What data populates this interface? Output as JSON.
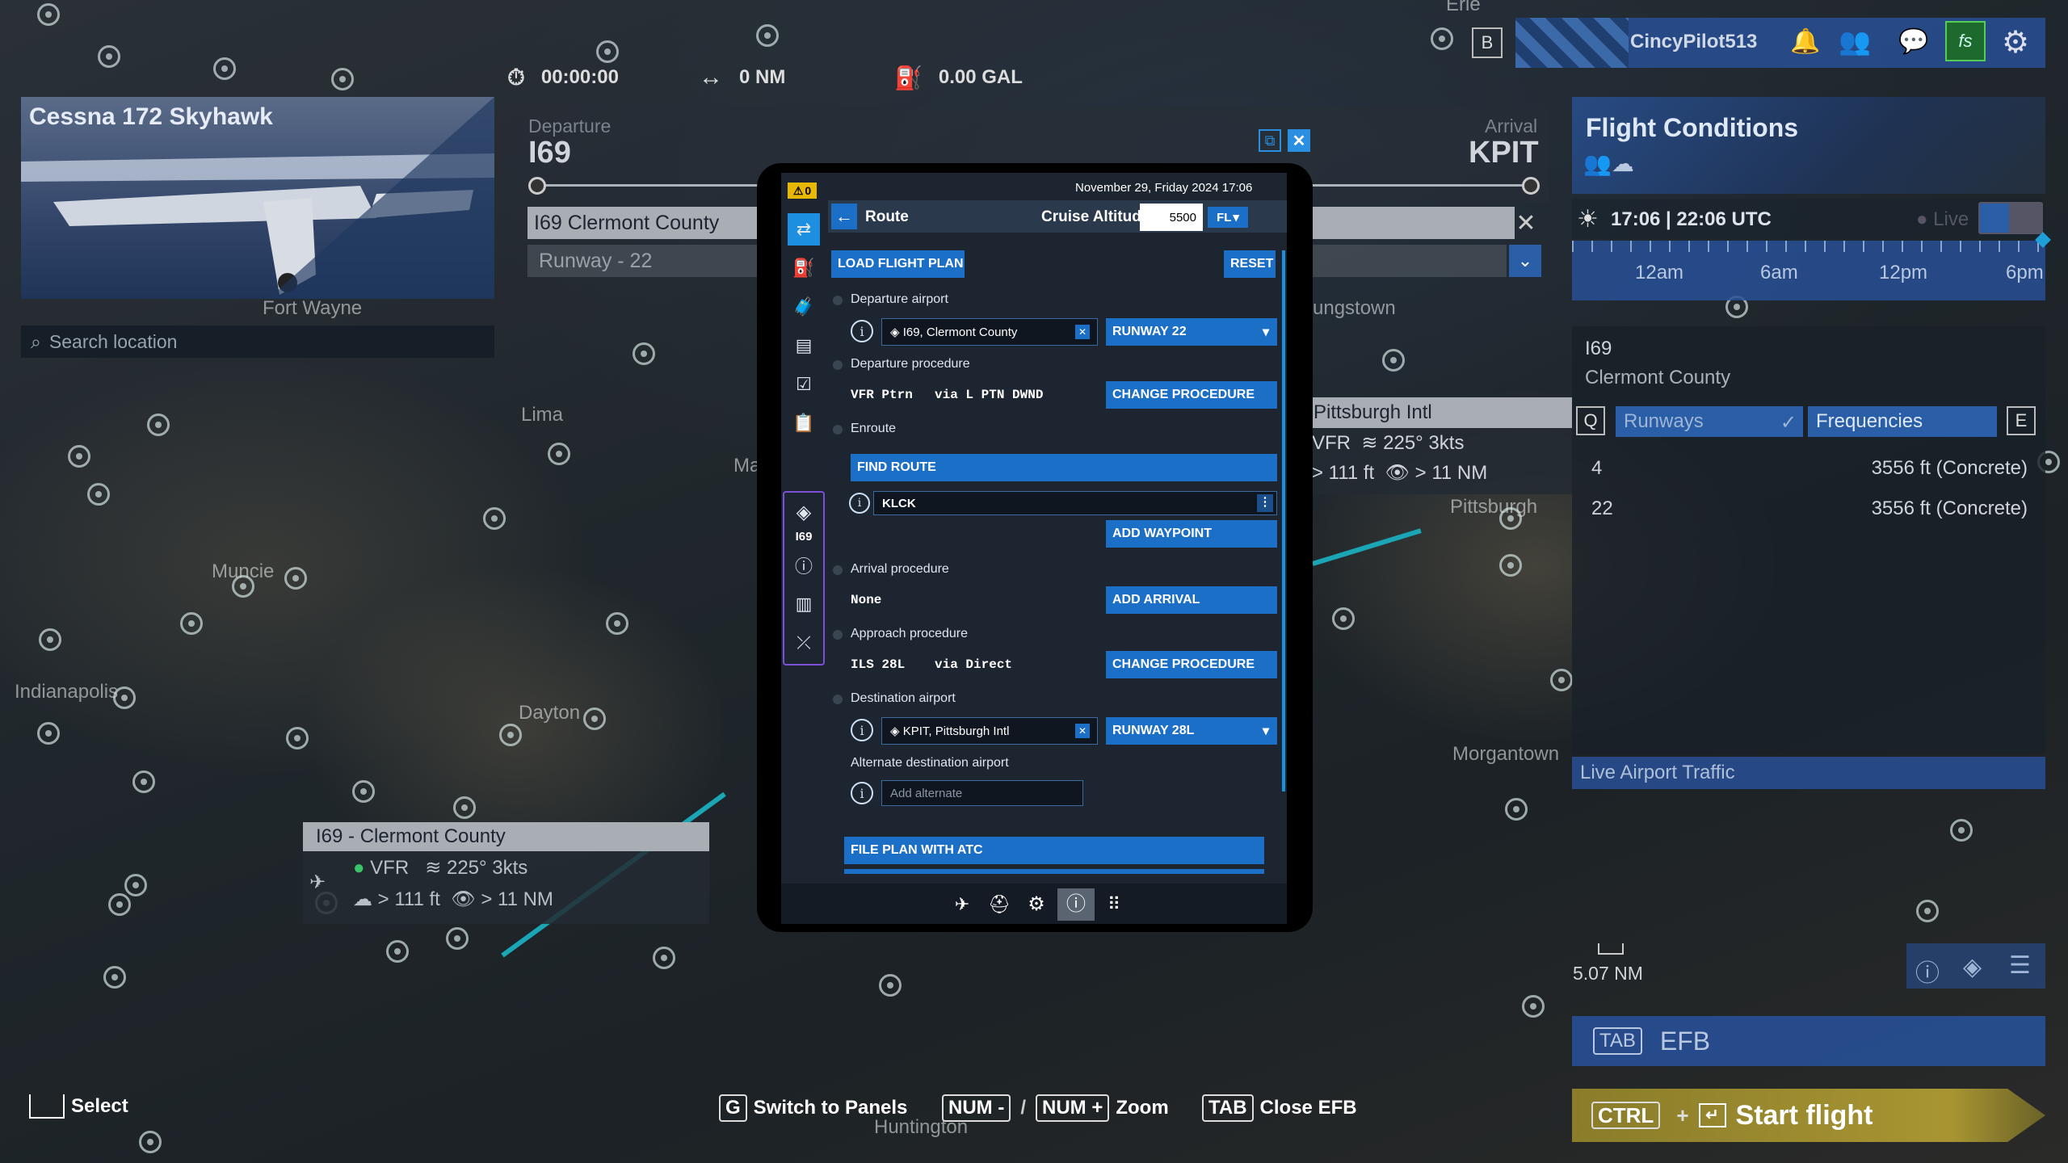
{
  "map": {
    "cities": [
      "Fort Wayne",
      "Lima",
      "Muncie",
      "Indianapolis",
      "Dayton",
      "Pittsburgh",
      "Morgantown",
      "Huntington",
      "Ma",
      "ungstown",
      "Erie"
    ]
  },
  "stats": {
    "time": "00:00:00",
    "distance": "0 NM",
    "fuel": "0.00 GAL"
  },
  "aircraft": {
    "name": "Cessna 172 Skyhawk",
    "search_placeholder": "Search location"
  },
  "departure": {
    "label": "Departure",
    "code": "I69",
    "name": "I69 Clermont County",
    "runway": "Runway - 22"
  },
  "arrival": {
    "label": "Arrival",
    "code": "KPIT"
  },
  "user": {
    "b_key": "B",
    "name": "CincyPilot513"
  },
  "flight_conditions": {
    "title": "Flight Conditions",
    "time": "17:06 | 22:06 UTC",
    "live": "Live",
    "ticks": [
      "12am",
      "6am",
      "12pm",
      "6pm"
    ]
  },
  "airport_info": {
    "code": "I69",
    "name": "Clermont County",
    "q_key": "Q",
    "e_key": "E",
    "tab_runways": "Runways",
    "tab_frequencies": "Frequencies",
    "runways": [
      {
        "id": "4",
        "info": "3556 ft (Concrete)"
      },
      {
        "id": "22",
        "info": "3556 ft (Concrete)"
      }
    ],
    "live_traffic": "Live Airport Traffic"
  },
  "pit_card": {
    "name": "Pittsburgh Intl",
    "rule": "VFR",
    "wind": "225° 3kts",
    "ceiling": "> 111 ft",
    "vis": "> 11 NM"
  },
  "i69_card": {
    "name": "I69 - Clermont County",
    "rule": "VFR",
    "wind": "225° 3kts",
    "ceiling": "> 111 ft",
    "vis": "> 11 NM"
  },
  "scale": "5.07 NM",
  "efb_tab": {
    "key": "TAB",
    "label": "EFB"
  },
  "start": {
    "ctrl": "CTRL",
    "plus": "+",
    "label": "Start flight"
  },
  "hints": {
    "select": "Select",
    "g": "G",
    "switch": "Switch to Panels",
    "num_minus": "NUM -",
    "slash": "/",
    "num_plus": "NUM +",
    "zoom": "Zoom",
    "tab": "TAB",
    "close_efb": "Close EFB"
  },
  "efb": {
    "badge": "0",
    "datetime": "November 29, Friday 2024 17:06",
    "title": "Route",
    "cruise_label": "Cruise Altitude",
    "cruise_value": "5500",
    "fl_label": "FL",
    "load_plan": "LOAD FLIGHT PLAN",
    "reset": "RESET",
    "dep_airport_label": "Departure airport",
    "dep_airport_value": "I69, Clermont County",
    "dep_runway": "RUNWAY 22",
    "dep_proc_label": "Departure procedure",
    "dep_proc_value": "VFR Ptrn",
    "dep_proc_via": "via L PTN DWND",
    "change_proc": "CHANGE PROCEDURE",
    "enroute_label": "Enroute",
    "find_route": "FIND ROUTE",
    "waypoint": "KLCK",
    "add_waypoint": "ADD WAYPOINT",
    "arr_proc_label": "Arrival procedure",
    "arr_proc_value": "None",
    "add_arrival": "ADD ARRIVAL",
    "app_proc_label": "Approach procedure",
    "app_proc_value": "ILS 28L",
    "app_proc_via": "via Direct",
    "change_proc2": "CHANGE PROCEDURE",
    "dest_label": "Destination airport",
    "dest_value": "KPIT, Pittsburgh Intl",
    "dest_runway": "RUNWAY 28L",
    "alt_label": "Alternate destination airport",
    "alt_placeholder": "Add alternate",
    "file_atc": "FILE PLAN WITH ATC",
    "sidebar_code": "I69"
  }
}
